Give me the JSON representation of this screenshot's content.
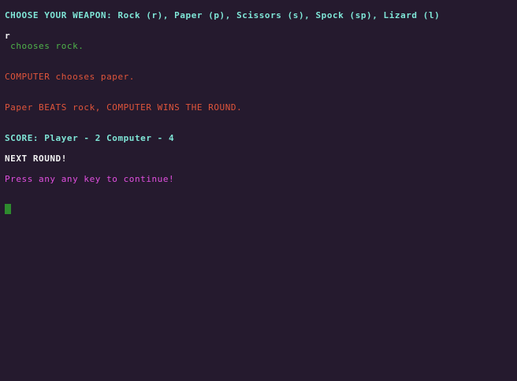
{
  "colors": {
    "background": "#251a2e",
    "prompt_cyan": "#7fe6d7",
    "input_white": "#f2f2f2",
    "player_green": "#4fb34a",
    "computer_red": "#e0553b",
    "result_red": "#e0553b",
    "score_cyan": "#7fe6d7",
    "next_white": "#f2f2f2",
    "continue_magenta": "#e24fe0",
    "cursor_green": "#2e8b2e"
  },
  "terminal": {
    "prompt": "CHOOSE YOUR WEAPON: Rock (r), Paper (p), Scissors (s), Spock (sp), Lizard (l)",
    "input": "r",
    "player_choice": " chooses rock.",
    "computer_choice": "COMPUTER chooses paper.",
    "round_result": "Paper BEATS rock, COMPUTER WINS THE ROUND.",
    "score": "SCORE: Player - 2 Computer - 4",
    "next_round": "NEXT ROUND!",
    "continue_prompt": "Press any any key to continue!"
  }
}
